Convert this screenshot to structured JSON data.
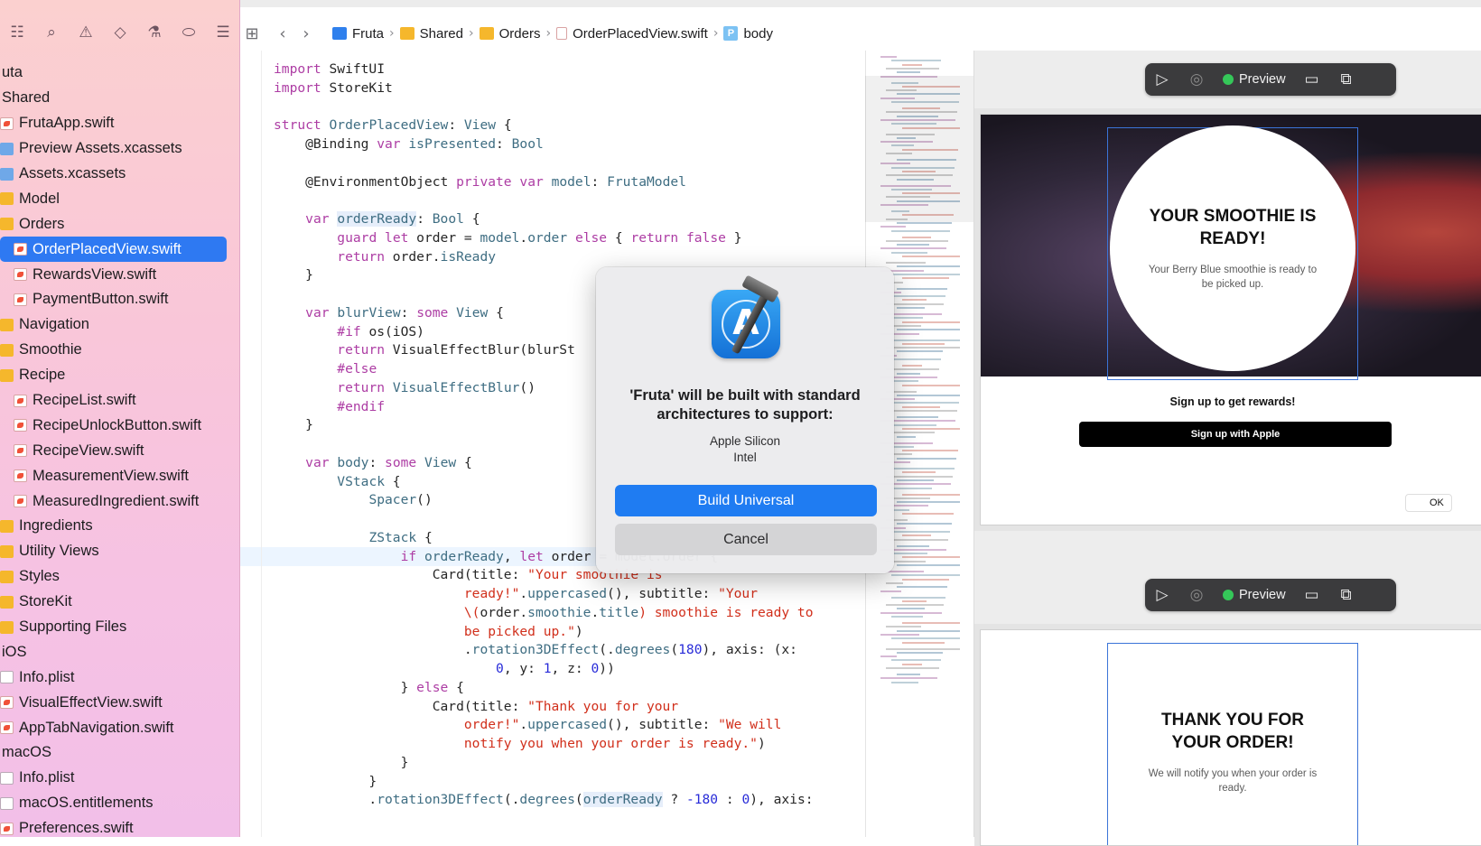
{
  "navigator": {
    "toolbar_icons": [
      "folder-icon",
      "source-control-icon",
      "symbol-icon",
      "find-icon",
      "issue-icon",
      "test-icon",
      "debug-icon",
      "breakpoint-icon",
      "report-icon"
    ],
    "items": [
      {
        "label": "uta",
        "indent": 0,
        "type": "group"
      },
      {
        "label": "Shared",
        "indent": 0,
        "type": "group"
      },
      {
        "label": "FrutaApp.swift",
        "indent": 1,
        "type": "swift"
      },
      {
        "label": "Preview Assets.xcassets",
        "indent": 1,
        "type": "assets"
      },
      {
        "label": "Assets.xcassets",
        "indent": 1,
        "type": "assets"
      },
      {
        "label": "Model",
        "indent": 1,
        "type": "folder"
      },
      {
        "label": "Orders",
        "indent": 1,
        "type": "folder"
      },
      {
        "label": "OrderPlacedView.swift",
        "indent": 2,
        "type": "swift",
        "selected": true
      },
      {
        "label": "RewardsView.swift",
        "indent": 2,
        "type": "swift"
      },
      {
        "label": "PaymentButton.swift",
        "indent": 2,
        "type": "swift"
      },
      {
        "label": "Navigation",
        "indent": 1,
        "type": "folder"
      },
      {
        "label": "Smoothie",
        "indent": 1,
        "type": "folder"
      },
      {
        "label": "Recipe",
        "indent": 1,
        "type": "folder"
      },
      {
        "label": "RecipeList.swift",
        "indent": 2,
        "type": "swift"
      },
      {
        "label": "RecipeUnlockButton.swift",
        "indent": 2,
        "type": "swift"
      },
      {
        "label": "RecipeView.swift",
        "indent": 2,
        "type": "swift"
      },
      {
        "label": "MeasurementView.swift",
        "indent": 2,
        "type": "swift"
      },
      {
        "label": "MeasuredIngredient.swift",
        "indent": 2,
        "type": "swift"
      },
      {
        "label": "Ingredients",
        "indent": 1,
        "type": "folder"
      },
      {
        "label": "Utility Views",
        "indent": 1,
        "type": "folder"
      },
      {
        "label": "Styles",
        "indent": 1,
        "type": "folder"
      },
      {
        "label": "StoreKit",
        "indent": 1,
        "type": "folder"
      },
      {
        "label": "Supporting Files",
        "indent": 1,
        "type": "folder"
      },
      {
        "label": "iOS",
        "indent": 0,
        "type": "group"
      },
      {
        "label": "Info.plist",
        "indent": 1,
        "type": "file"
      },
      {
        "label": "VisualEffectView.swift",
        "indent": 1,
        "type": "swift"
      },
      {
        "label": "AppTabNavigation.swift",
        "indent": 1,
        "type": "swift"
      },
      {
        "label": "macOS",
        "indent": 0,
        "type": "group"
      },
      {
        "label": "Info.plist",
        "indent": 1,
        "type": "file"
      },
      {
        "label": "macOS.entitlements",
        "indent": 1,
        "type": "file"
      },
      {
        "label": "Preferences.swift",
        "indent": 1,
        "type": "swift"
      }
    ]
  },
  "jumpbar": {
    "crumbs": [
      {
        "label": "Fruta",
        "icon": "project-icon"
      },
      {
        "label": "Shared",
        "icon": "folder-icon"
      },
      {
        "label": "Orders",
        "icon": "folder-icon"
      },
      {
        "label": "OrderPlacedView.swift",
        "icon": "swift-file-icon"
      },
      {
        "label": "body",
        "icon": "property-icon"
      }
    ],
    "property_badge": "P"
  },
  "code": {
    "lines": [
      [
        [
          "kw",
          "import"
        ],
        [
          "pl",
          " SwiftUI"
        ]
      ],
      [
        [
          "kw",
          "import"
        ],
        [
          "pl",
          " StoreKit"
        ]
      ],
      [],
      [
        [
          "kw",
          "struct"
        ],
        [
          "pl",
          " "
        ],
        [
          "ty",
          "OrderPlacedView"
        ],
        [
          "pl",
          ": "
        ],
        [
          "ty",
          "View"
        ],
        [
          "pl",
          " {"
        ]
      ],
      [
        [
          "pl",
          "    @Binding "
        ],
        [
          "kw",
          "var"
        ],
        [
          "pl",
          " "
        ],
        [
          "ty",
          "isPresented"
        ],
        [
          "pl",
          ": "
        ],
        [
          "ty",
          "Bool"
        ]
      ],
      [],
      [
        [
          "pl",
          "    @EnvironmentObject "
        ],
        [
          "kw",
          "private"
        ],
        [
          "pl",
          " "
        ],
        [
          "kw",
          "var"
        ],
        [
          "pl",
          " "
        ],
        [
          "ty",
          "model"
        ],
        [
          "pl",
          ": "
        ],
        [
          "ty",
          "FrutaModel"
        ]
      ],
      [],
      [
        [
          "pl",
          "    "
        ],
        [
          "kw",
          "var"
        ],
        [
          "pl",
          " "
        ],
        [
          "hl",
          "orderReady"
        ],
        [
          "pl",
          ": "
        ],
        [
          "ty",
          "Bool"
        ],
        [
          "pl",
          " {"
        ]
      ],
      [
        [
          "pl",
          "        "
        ],
        [
          "kw",
          "guard"
        ],
        [
          "pl",
          " "
        ],
        [
          "kw",
          "let"
        ],
        [
          "pl",
          " order = "
        ],
        [
          "ty",
          "model"
        ],
        [
          "pl",
          "."
        ],
        [
          "ty",
          "order"
        ],
        [
          "pl",
          " "
        ],
        [
          "kw",
          "else"
        ],
        [
          "pl",
          " { "
        ],
        [
          "kw",
          "return"
        ],
        [
          "pl",
          " "
        ],
        [
          "kw",
          "false"
        ],
        [
          "pl",
          " }"
        ]
      ],
      [
        [
          "pl",
          "        "
        ],
        [
          "kw",
          "return"
        ],
        [
          "pl",
          " order."
        ],
        [
          "ty",
          "isReady"
        ]
      ],
      [
        [
          "pl",
          "    }"
        ]
      ],
      [],
      [
        [
          "pl",
          "    "
        ],
        [
          "kw",
          "var"
        ],
        [
          "pl",
          " "
        ],
        [
          "ty",
          "blurView"
        ],
        [
          "pl",
          ": "
        ],
        [
          "kw",
          "some"
        ],
        [
          "pl",
          " "
        ],
        [
          "ty",
          "View"
        ],
        [
          "pl",
          " {"
        ]
      ],
      [
        [
          "pl",
          "        "
        ],
        [
          "kw",
          "#if"
        ],
        [
          "pl",
          " os(iOS)"
        ]
      ],
      [
        [
          "pl",
          "        "
        ],
        [
          "kw",
          "return"
        ],
        [
          "pl",
          " VisualEffectBlur(blurSt"
        ]
      ],
      [
        [
          "pl",
          "        "
        ],
        [
          "kw",
          "#else"
        ]
      ],
      [
        [
          "pl",
          "        "
        ],
        [
          "kw",
          "return"
        ],
        [
          "pl",
          " "
        ],
        [
          "ty",
          "VisualEffectBlur"
        ],
        [
          "pl",
          "()"
        ]
      ],
      [
        [
          "pl",
          "        "
        ],
        [
          "kw",
          "#endif"
        ]
      ],
      [
        [
          "pl",
          "    }"
        ]
      ],
      [],
      [
        [
          "pl",
          "    "
        ],
        [
          "kw",
          "var"
        ],
        [
          "pl",
          " "
        ],
        [
          "ty",
          "body"
        ],
        [
          "pl",
          ": "
        ],
        [
          "kw",
          "some"
        ],
        [
          "pl",
          " "
        ],
        [
          "ty",
          "View"
        ],
        [
          "pl",
          " {"
        ]
      ],
      [
        [
          "pl",
          "        "
        ],
        [
          "ty",
          "VStack"
        ],
        [
          "pl",
          " {"
        ]
      ],
      [
        [
          "pl",
          "            "
        ],
        [
          "ty",
          "Spacer"
        ],
        [
          "pl",
          "()"
        ]
      ],
      [],
      [
        [
          "pl",
          "            "
        ],
        [
          "ty",
          "ZStack"
        ],
        [
          "pl",
          " {"
        ]
      ],
      [
        [
          "pl",
          "                "
        ],
        [
          "kw",
          "if"
        ],
        [
          "pl",
          " "
        ],
        [
          "ty",
          "orderReady"
        ],
        [
          "pl",
          ", "
        ],
        [
          "kw",
          "let"
        ],
        [
          "pl",
          " order = model.order {"
        ]
      ],
      [
        [
          "pl",
          "                    Card(title: "
        ],
        [
          "st",
          "\"Your smoothie is"
        ]
      ],
      [
        [
          "st",
          "                        ready!\""
        ],
        [
          "pl",
          "."
        ],
        [
          "ty",
          "uppercased"
        ],
        [
          "pl",
          "(), subtitle: "
        ],
        [
          "st",
          "\"Your"
        ]
      ],
      [
        [
          "st",
          "                        \\("
        ],
        [
          "pl",
          "order."
        ],
        [
          "ty",
          "smoothie"
        ],
        [
          "pl",
          "."
        ],
        [
          "ty",
          "title"
        ],
        [
          "st",
          ") smoothie is ready to"
        ]
      ],
      [
        [
          "st",
          "                        be picked up.\""
        ],
        [
          "pl",
          ")"
        ]
      ],
      [
        [
          "pl",
          "                        ."
        ],
        [
          "ty",
          "rotation3DEffect"
        ],
        [
          "pl",
          "(."
        ],
        [
          "ty",
          "degrees"
        ],
        [
          "pl",
          "("
        ],
        [
          "nu",
          "180"
        ],
        [
          "pl",
          "), axis: (x:"
        ]
      ],
      [
        [
          "pl",
          "                            "
        ],
        [
          "nu",
          "0"
        ],
        [
          "pl",
          ", y: "
        ],
        [
          "nu",
          "1"
        ],
        [
          "pl",
          ", z: "
        ],
        [
          "nu",
          "0"
        ],
        [
          "pl",
          "))"
        ]
      ],
      [
        [
          "pl",
          "                } "
        ],
        [
          "kw",
          "else"
        ],
        [
          "pl",
          " {"
        ]
      ],
      [
        [
          "pl",
          "                    Card(title: "
        ],
        [
          "st",
          "\"Thank you for your"
        ]
      ],
      [
        [
          "st",
          "                        order!\""
        ],
        [
          "pl",
          "."
        ],
        [
          "ty",
          "uppercased"
        ],
        [
          "pl",
          "(), subtitle: "
        ],
        [
          "st",
          "\"We will"
        ]
      ],
      [
        [
          "st",
          "                        notify you when your order is ready.\""
        ],
        [
          "pl",
          ")"
        ]
      ],
      [
        [
          "pl",
          "                }"
        ]
      ],
      [
        [
          "pl",
          "            }"
        ]
      ],
      [
        [
          "pl",
          "            ."
        ],
        [
          "ty",
          "rotation3DEffect"
        ],
        [
          "pl",
          "(."
        ],
        [
          "ty",
          "degrees"
        ],
        [
          "pl",
          "("
        ],
        [
          "hl",
          "orderReady"
        ],
        [
          "pl",
          " ? "
        ],
        [
          "nu",
          "-180"
        ],
        [
          "pl",
          " : "
        ],
        [
          "nu",
          "0"
        ],
        [
          "pl",
          "), axis:"
        ]
      ]
    ]
  },
  "colors": {
    "keyword": "#ad3da4",
    "type": "#3e6d82",
    "string": "#d12f1b",
    "number": "#272ad8",
    "plain": "#262626",
    "accent": "#1f7cf2",
    "selection": "#2e79f2"
  },
  "alert": {
    "title": "'Fruta' will be built with standard architectures to support:",
    "info_line1": "Apple Silicon",
    "info_line2": "Intel",
    "primary_button": "Build Universal",
    "cancel_button": "Cancel",
    "icon": "xcode-icon"
  },
  "canvas": {
    "preview1": {
      "label": "Preview",
      "card_title": "YOUR SMOOTHIE IS READY!",
      "card_subtitle": "Your Berry Blue smoothie is ready to be picked up.",
      "rewards_text": "Sign up to get rewards!",
      "apple_button": " Sign up with Apple",
      "ok_label": "OK"
    },
    "preview2": {
      "label": "Preview",
      "card_title": "THANK YOU FOR YOUR ORDER!",
      "card_subtitle": "We will notify you when your order is ready."
    },
    "toolbar_icons": [
      "live-preview-icon",
      "inspect-icon",
      "device-settings-icon",
      "duplicate-preview-icon"
    ]
  }
}
